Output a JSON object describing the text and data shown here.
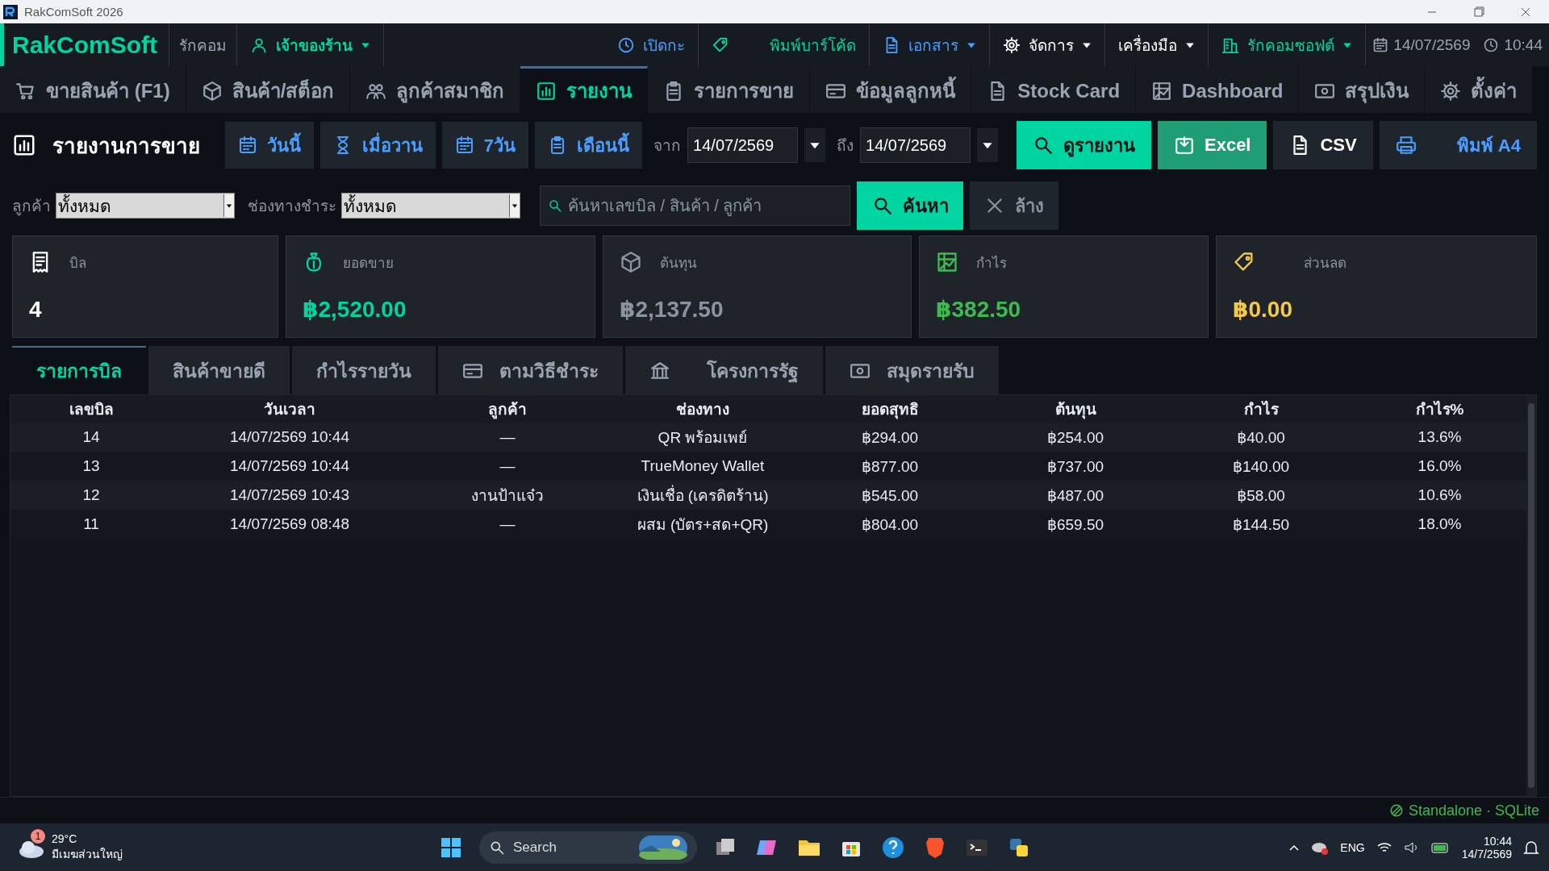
{
  "window": {
    "title": "RakComSoft 2026"
  },
  "menu_bar": {
    "logo": "RakComSoft",
    "shop": "รักคอม",
    "user": {
      "label": "เจ้าของร้าน",
      "kind": "accent",
      "dropdown": true
    },
    "items": [
      {
        "label": "เปิดกะ",
        "kind": "link",
        "dropdown": false
      },
      {
        "label": "พิมพ์บาร์โค้ด",
        "kind": "accent",
        "dropdown": false
      },
      {
        "label": "เอกสาร",
        "kind": "link",
        "dropdown": true
      },
      {
        "label": "จัดการ",
        "kind": "plain",
        "dropdown": true
      },
      {
        "label": "เครื่องมือ",
        "kind": "plain",
        "dropdown": true
      },
      {
        "label": "รักคอมซอฟต์",
        "kind": "accent",
        "dropdown": true
      }
    ],
    "date": "14/07/2569",
    "time": "10:44"
  },
  "nav_tabs": [
    {
      "label": "ขายสินค้า (F1)",
      "selected": false
    },
    {
      "label": "สินค้า/สต็อก",
      "selected": false
    },
    {
      "label": "ลูกค้าสมาชิก",
      "selected": false
    },
    {
      "label": "รายงาน",
      "selected": true
    },
    {
      "label": "รายการขาย",
      "selected": false
    },
    {
      "label": "ข้อมูลลูกหนี้",
      "selected": false
    },
    {
      "label": "Stock Card",
      "selected": false
    },
    {
      "label": "Dashboard",
      "selected": false
    },
    {
      "label": "สรุปเงิน",
      "selected": false
    },
    {
      "label": "ตั้งค่า",
      "selected": false
    }
  ],
  "report": {
    "title": "รายงานการขาย",
    "quick_ranges": [
      "วันนี้",
      "เมื่อวาน",
      "7วัน",
      "เดือนนี้"
    ],
    "date_from": {
      "label": "จาก",
      "value": "14/07/2569"
    },
    "date_to": {
      "label": "ถึง",
      "value": "14/07/2569"
    },
    "actions": [
      {
        "label": "ดูรายงาน",
        "kind": "primary"
      },
      {
        "label": "Excel",
        "kind": "success"
      },
      {
        "label": "CSV",
        "kind": "plain"
      },
      {
        "label": "พิมพ์ A4",
        "kind": "print"
      }
    ]
  },
  "filters": {
    "customer": {
      "label": "ลูกค้า",
      "value": "ทั้งหมด"
    },
    "payment": {
      "label": "ช่องทางชำระ",
      "value": "ทั้งหมด"
    },
    "search": {
      "placeholder": "ค้นหาเลขบิล / สินค้า / ลูกค้า"
    },
    "buttons": [
      {
        "label": "ค้นหา",
        "kind": "primary"
      },
      {
        "label": "ล้าง",
        "kind": "plain"
      }
    ]
  },
  "cards": [
    {
      "label": "บิล",
      "value": "4",
      "color": "#ffffff"
    },
    {
      "label": "ยอดขาย",
      "value": "฿2,520.00",
      "color": "#00d4a0"
    },
    {
      "label": "ต้นทุน",
      "value": "฿2,137.50",
      "color": "#8b949e"
    },
    {
      "label": "กำไร",
      "value": "฿382.50",
      "color": "#3fb950"
    },
    {
      "label": "ส่วนลด",
      "value": "฿0.00",
      "color": "#f2c94c"
    }
  ],
  "sub_tabs": [
    {
      "label": "รายการบิล",
      "selected": true
    },
    {
      "label": "สินค้าขายดี",
      "selected": false
    },
    {
      "label": "กำไรรายวัน",
      "selected": false
    },
    {
      "label": "ตามวิธีชำระ",
      "selected": false
    },
    {
      "label": "โครงการรัฐ",
      "selected": false
    },
    {
      "label": "สมุดรายรับ",
      "selected": false
    }
  ],
  "table": {
    "columns": [
      "เลขบิล",
      "วันเวลา",
      "ลูกค้า",
      "ช่องทาง",
      "ยอดสุทธิ",
      "ต้นทุน",
      "กำไร",
      "กำไร%"
    ],
    "rows": [
      [
        "14",
        "14/07/2569 10:44",
        "—",
        "QR พร้อมเพย์",
        "฿294.00",
        "฿254.00",
        "฿40.00",
        "13.6%"
      ],
      [
        "13",
        "14/07/2569 10:44",
        "—",
        "TrueMoney Wallet",
        "฿877.00",
        "฿737.00",
        "฿140.00",
        "16.0%"
      ],
      [
        "12",
        "14/07/2569 10:43",
        "งานป้าแจ๋ว",
        "เงินเชื่อ (เครดิตร้าน)",
        "฿545.00",
        "฿487.00",
        "฿58.00",
        "10.6%"
      ],
      [
        "11",
        "14/07/2569 08:48",
        "—",
        "ผสม (บัตร+สด+QR)",
        "฿804.00",
        "฿659.50",
        "฿144.50",
        "18.0%"
      ]
    ]
  },
  "status_bar": {
    "mode": "Standalone · SQLite"
  },
  "taskbar": {
    "weather": {
      "badge": "1",
      "temperature": "29°C",
      "condition": "มีเมฆส่วนใหญ่"
    },
    "search": {
      "placeholder": "Search"
    },
    "language": "ENG",
    "time": "10:44",
    "date": "14/7/2569"
  }
}
